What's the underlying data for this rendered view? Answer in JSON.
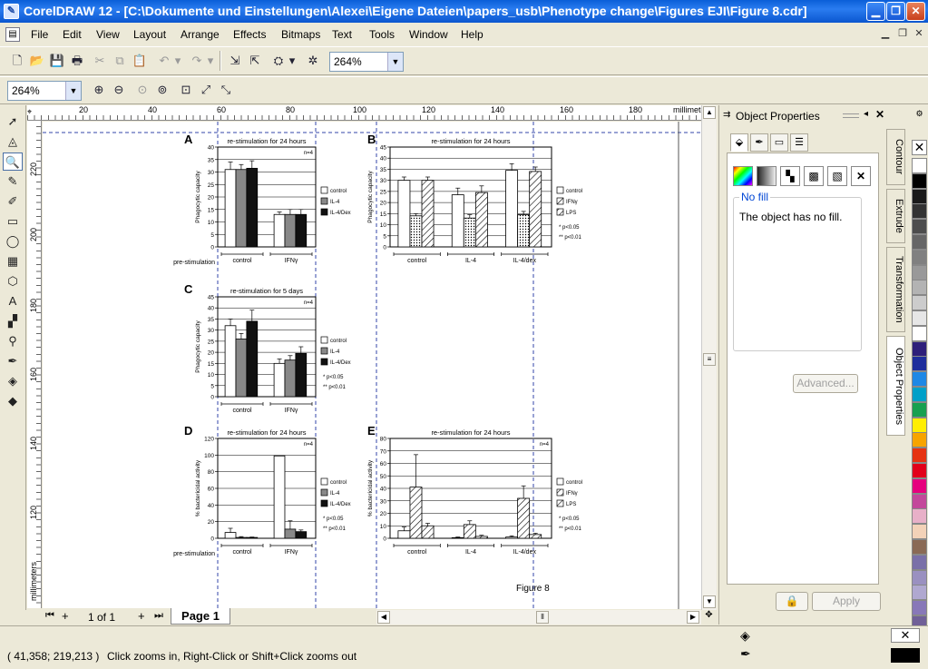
{
  "window": {
    "title": "CorelDRAW 12 - [C:\\Dokumente und Einstellungen\\Alexei\\Eigene Dateien\\papers_usb\\Phenotype change\\Figures EJI\\Figure 8.cdr]"
  },
  "menu": [
    "File",
    "Edit",
    "View",
    "Layout",
    "Arrange",
    "Effects",
    "Bitmaps",
    "Text",
    "Tools",
    "Window",
    "Help"
  ],
  "toolbar": {
    "zoom_value": "264%"
  },
  "propbar": {
    "zoom_value": "264%"
  },
  "ruler": {
    "top_units": "millimeters",
    "top_ticks": [
      "20",
      "40",
      "60",
      "80",
      "100",
      "120",
      "140",
      "160",
      "180"
    ],
    "left_units": "millimeters",
    "left_ticks": [
      "220",
      "200",
      "180",
      "160",
      "140",
      "120"
    ]
  },
  "pages": {
    "counter": "1 of 1",
    "tab": "Page 1"
  },
  "docker": {
    "title": "Object Properties",
    "fill_group": "No fill",
    "fill_message": "The object has no fill.",
    "advanced_button": "Advanced...",
    "apply_button": "Apply"
  },
  "dock_tabs": [
    "Contour",
    "Extrude",
    "Transformation",
    "Object Properties"
  ],
  "palette": [
    "#ffffff",
    "#000000",
    "#1a1a1a",
    "#333333",
    "#4d4d4d",
    "#666666",
    "#808080",
    "#999999",
    "#b3b3b3",
    "#cccccc",
    "#e6e6e6",
    "#ffffff",
    "#2e1f7a",
    "#1f2e9c",
    "#1e88e5",
    "#00a0c8",
    "#18a050",
    "#ffee00",
    "#f7a400",
    "#e63312",
    "#e2001a",
    "#e6007e",
    "#c3489b",
    "#e8b0c8",
    "#f3d2b8",
    "#8a6a55",
    "#7a70a8",
    "#9a90c0",
    "#b0a8d0",
    "#8878b8",
    "#706098",
    "#5a4e80"
  ],
  "status": {
    "coords": "( 41,358; 219,213 )",
    "hint": "Click zooms in, Right-Click or Shift+Click zooms out"
  },
  "figure": {
    "caption": "Figure 8",
    "prestim_label": "pre-stimulation",
    "panels": {
      "A": {
        "letter": "A",
        "subtitle": "re-stimulation for 24 hours",
        "n": "n=4",
        "ylabel": "Phagocytic capacity",
        "categories": [
          "control",
          "IFNγ"
        ],
        "legend": [
          "control",
          "IL-4",
          "IL-4/Dex"
        ]
      },
      "B": {
        "letter": "B",
        "subtitle": "re-stimulation for 24 hours",
        "ylabel": "Phagocytic capacity",
        "categories": [
          "control",
          "IL-4",
          "IL-4/dex"
        ],
        "legend": [
          "control",
          "IFNγ",
          "LPS"
        ],
        "stars": [
          "* p<0.05",
          "** p<0.01"
        ]
      },
      "C": {
        "letter": "C",
        "subtitle": "re-stimulation for 5 days",
        "n": "n=4",
        "ylabel": "Phagocytic capacity",
        "categories": [
          "control",
          "IFNγ"
        ],
        "legend": [
          "control",
          "IL-4",
          "IL-4/Dex"
        ],
        "stars": [
          "* p<0.05",
          "** p<0.01"
        ]
      },
      "D": {
        "letter": "D",
        "subtitle": "re-stimulation for 24 hours",
        "n": "n=4",
        "ylabel": "% bactericidal activity",
        "categories": [
          "control",
          "IFNγ"
        ],
        "legend": [
          "control",
          "IL-4",
          "IL-4/Dex"
        ],
        "stars": [
          "* p<0.05",
          "** p<0.01"
        ]
      },
      "E": {
        "letter": "E",
        "subtitle": "re-stimulation for 24 hours",
        "n": "n=4",
        "ylabel": "% bactericidal activity",
        "categories": [
          "control",
          "IL-4",
          "IL-4/dex"
        ],
        "legend": [
          "control",
          "IFNγ",
          "LPS"
        ],
        "stars": [
          "* p<0.05",
          "** p<0.01"
        ]
      }
    }
  },
  "chart_data": [
    {
      "type": "bar",
      "panel": "A",
      "title": "re-stimulation for 24 hours",
      "ylabel": "Phagocytic capacity",
      "ylim": [
        0,
        40
      ],
      "yticks": [
        0,
        5,
        10,
        15,
        20,
        25,
        30,
        35,
        40
      ],
      "categories": [
        "control",
        "IFNγ"
      ],
      "series": [
        {
          "name": "control",
          "values": [
            31,
            13
          ],
          "errors": [
            3,
            1
          ]
        },
        {
          "name": "IL-4",
          "values": [
            31,
            13
          ],
          "errors": [
            2,
            2
          ]
        },
        {
          "name": "IL-4/Dex",
          "values": [
            31.5,
            13
          ],
          "errors": [
            3,
            2
          ]
        }
      ]
    },
    {
      "type": "bar",
      "panel": "B",
      "title": "re-stimulation for 24 hours",
      "ylabel": "Phagocytic capacity",
      "ylim": [
        0,
        45
      ],
      "yticks": [
        0,
        5,
        10,
        15,
        20,
        25,
        30,
        35,
        40,
        45
      ],
      "categories": [
        "control",
        "IL-4",
        "IL-4/dex"
      ],
      "series": [
        {
          "name": "control",
          "values": [
            30,
            23.5,
            34.5
          ],
          "errors": [
            1.5,
            3,
            3
          ]
        },
        {
          "name": "IFNγ",
          "values": [
            14,
            13,
            14.5
          ],
          "errors": [
            1,
            1.5,
            1.5
          ]
        },
        {
          "name": "LPS",
          "values": [
            30,
            24.5,
            34
          ],
          "errors": [
            1.5,
            3,
            2
          ]
        }
      ]
    },
    {
      "type": "bar",
      "panel": "C",
      "title": "re-stimulation for 5 days",
      "ylabel": "Phagocytic capacity",
      "ylim": [
        0,
        45
      ],
      "yticks": [
        0,
        5,
        10,
        15,
        20,
        25,
        30,
        35,
        40,
        45
      ],
      "categories": [
        "control",
        "IFNγ"
      ],
      "series": [
        {
          "name": "control",
          "values": [
            32,
            15
          ],
          "errors": [
            3,
            2
          ]
        },
        {
          "name": "IL-4",
          "values": [
            26,
            16.5
          ],
          "errors": [
            2.5,
            2
          ]
        },
        {
          "name": "IL-4/Dex",
          "values": [
            34,
            19.5
          ],
          "errors": [
            5,
            3
          ]
        }
      ]
    },
    {
      "type": "bar",
      "panel": "D",
      "title": "re-stimulation for 24 hours",
      "ylabel": "% bactericidal activity",
      "ylim": [
        0,
        120
      ],
      "yticks": [
        0,
        20,
        40,
        60,
        80,
        100,
        120
      ],
      "categories": [
        "control",
        "IFNγ"
      ],
      "series": [
        {
          "name": "control",
          "values": [
            7,
            99
          ],
          "errors": [
            5,
            0
          ]
        },
        {
          "name": "IL-4",
          "values": [
            1,
            11
          ],
          "errors": [
            1,
            10
          ]
        },
        {
          "name": "IL-4/Dex",
          "values": [
            1,
            8
          ],
          "errors": [
            0.5,
            2
          ]
        }
      ]
    },
    {
      "type": "bar",
      "panel": "E",
      "title": "re-stimulation for 24 hours",
      "ylabel": "% bactericidal activity",
      "ylim": [
        0,
        80
      ],
      "yticks": [
        0,
        10,
        20,
        30,
        40,
        50,
        60,
        70,
        80
      ],
      "categories": [
        "control",
        "IL-4",
        "IL-4/dex"
      ],
      "series": [
        {
          "name": "control",
          "values": [
            6,
            0.5,
            1
          ],
          "errors": [
            3,
            0.5,
            1
          ]
        },
        {
          "name": "IFNγ",
          "values": [
            41,
            11,
            32
          ],
          "errors": [
            26,
            3,
            10
          ]
        },
        {
          "name": "LPS",
          "values": [
            10,
            1.5,
            3
          ],
          "errors": [
            2,
            1,
            1
          ]
        }
      ]
    }
  ]
}
